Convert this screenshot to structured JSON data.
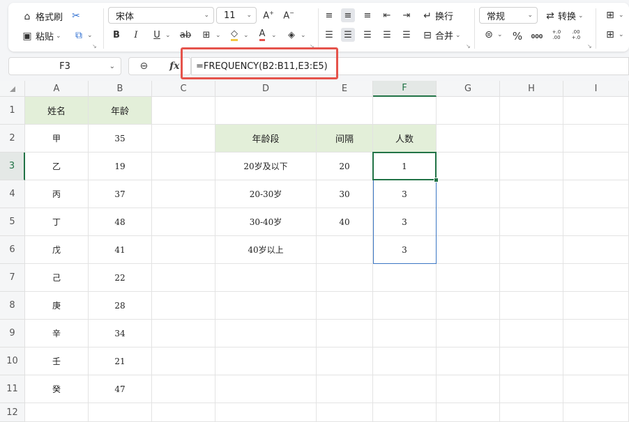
{
  "ribbon": {
    "format_painter": "格式刷",
    "paste": "粘贴",
    "font_name": "宋体",
    "font_size": "11",
    "wrap": "换行",
    "merge": "合并",
    "number_format": "常规",
    "convert": "转换",
    "percent": "%",
    "thousands": "000",
    "inc_decimal": "+.0\n.00",
    "dec_decimal": ".00\n+.0"
  },
  "formula_bar": {
    "name_box": "F3",
    "fx": "fx",
    "formula": "=FREQUENCY(B2:B11,E3:E5)"
  },
  "columns": [
    "A",
    "B",
    "C",
    "D",
    "E",
    "F",
    "G",
    "H",
    "I"
  ],
  "rows": [
    "1",
    "2",
    "3",
    "4",
    "5",
    "6",
    "7",
    "8",
    "9",
    "10",
    "11",
    "12"
  ],
  "cells": {
    "A1": "姓名",
    "B1": "年龄",
    "A2": "甲",
    "B2": "35",
    "A3": "乙",
    "B3": "19",
    "A4": "丙",
    "B4": "37",
    "A5": "丁",
    "B5": "48",
    "A6": "戊",
    "B6": "41",
    "A7": "己",
    "B7": "22",
    "A8": "庚",
    "B8": "28",
    "A9": "辛",
    "B9": "34",
    "A10": "壬",
    "B10": "21",
    "A11": "癸",
    "B11": "47",
    "D2": "年龄段",
    "E2": "间隔",
    "F2": "人数",
    "D3": "20岁及以下",
    "E3": "20",
    "F3": "1",
    "D4": "20-30岁",
    "E4": "30",
    "F4": "3",
    "D5": "30-40岁",
    "E5": "40",
    "F5": "3",
    "D6": "40岁以上",
    "F6": "3"
  },
  "colors": {
    "header_fill": "#e3efd9",
    "active_green": "#217346",
    "selection_blue": "#3b76c4",
    "annotation_red": "#e5534b"
  }
}
